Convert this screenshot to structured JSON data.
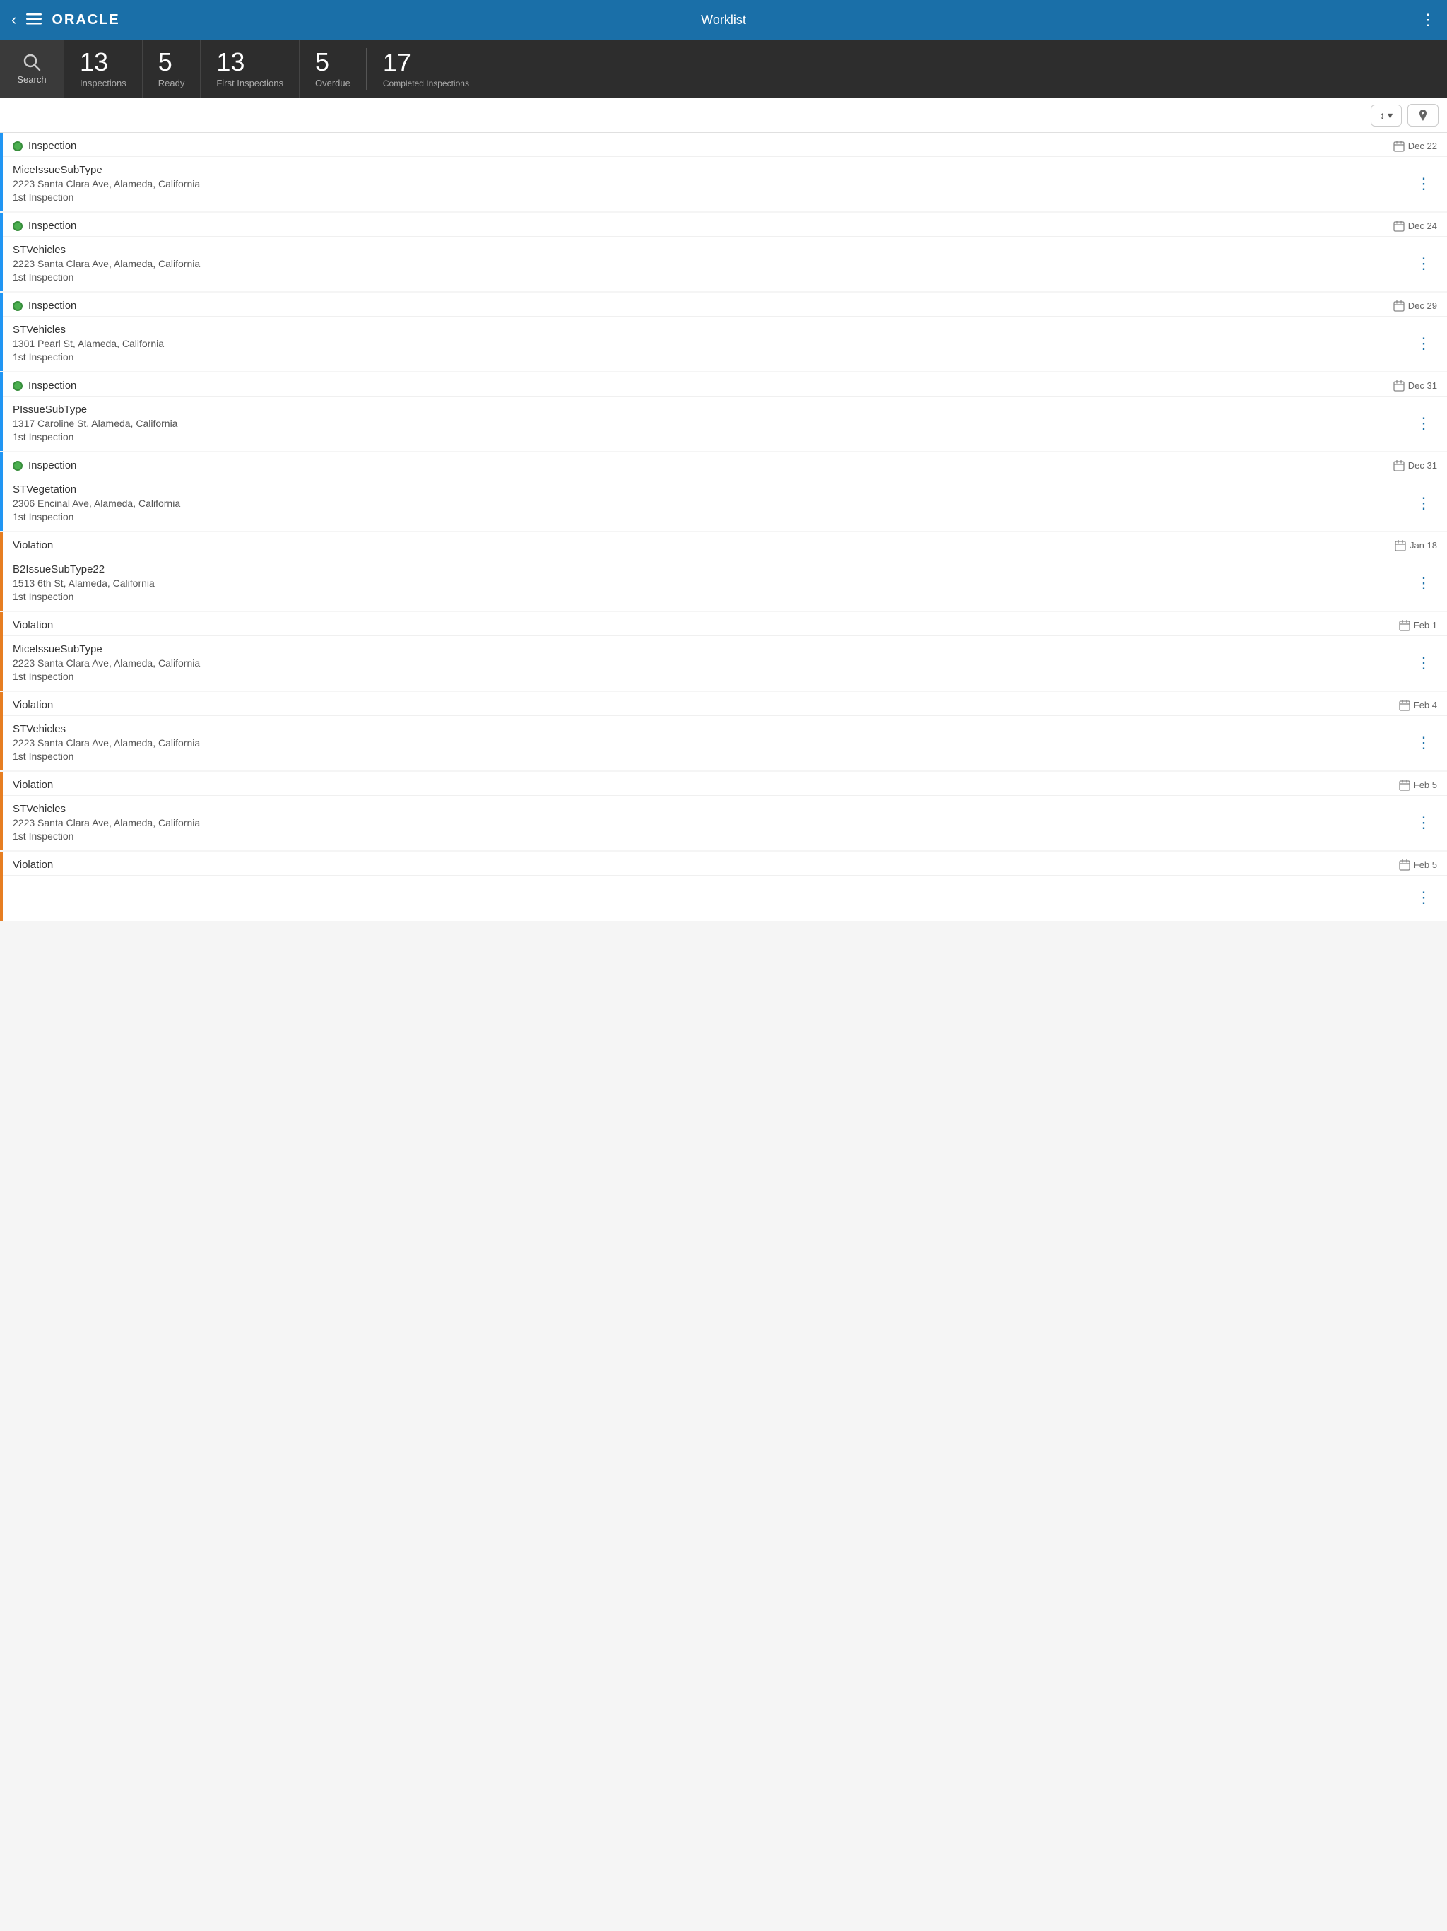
{
  "nav": {
    "title": "Worklist",
    "back_icon": "‹",
    "menu_icon": "☰",
    "more_icon": "⋮",
    "logo": "ORACLE"
  },
  "stats": {
    "search_label": "Search",
    "inspections_count": "13",
    "inspections_label": "Inspections",
    "ready_count": "5",
    "ready_label": "Ready",
    "first_inspections_count": "13",
    "first_inspections_label": "First Inspections",
    "overdue_count": "5",
    "overdue_label": "Overdue",
    "completed_count": "17",
    "completed_label": "Completed Inspections"
  },
  "toolbar": {
    "sort_label": "↕",
    "sort_arrow": "▾",
    "location_icon": "📍"
  },
  "items": [
    {
      "type": "Inspection",
      "has_dot": true,
      "dot_color": "green",
      "border": "blue",
      "date": "Dec 22",
      "subtype": "MiceIssueSubType",
      "address": "2223 Santa Clara Ave, Alameda, California",
      "inspection_type": "1st Inspection"
    },
    {
      "type": "Inspection",
      "has_dot": true,
      "dot_color": "green",
      "border": "blue",
      "date": "Dec 24",
      "subtype": "STVehicles",
      "address": "2223 Santa Clara Ave, Alameda, California",
      "inspection_type": "1st Inspection"
    },
    {
      "type": "Inspection",
      "has_dot": true,
      "dot_color": "green",
      "border": "blue",
      "date": "Dec 29",
      "subtype": "STVehicles",
      "address": "1301 Pearl St, Alameda, California",
      "inspection_type": "1st Inspection"
    },
    {
      "type": "Inspection",
      "has_dot": true,
      "dot_color": "green",
      "border": "blue",
      "date": "Dec 31",
      "subtype": "PIssueSubType",
      "address": "1317 Caroline St, Alameda, California",
      "inspection_type": "1st Inspection"
    },
    {
      "type": "Inspection",
      "has_dot": true,
      "dot_color": "green",
      "border": "blue",
      "date": "Dec 31",
      "subtype": "STVegetation",
      "address": "2306 Encinal Ave, Alameda, California",
      "inspection_type": "1st Inspection"
    },
    {
      "type": "Violation",
      "has_dot": false,
      "border": "orange",
      "date": "Jan 18",
      "subtype": "B2IssueSubType22",
      "address": "1513 6th St, Alameda, California",
      "inspection_type": "1st Inspection"
    },
    {
      "type": "Violation",
      "has_dot": false,
      "border": "orange",
      "date": "Feb 1",
      "subtype": "MiceIssueSubType",
      "address": "2223 Santa Clara Ave, Alameda, California",
      "inspection_type": "1st Inspection"
    },
    {
      "type": "Violation",
      "has_dot": false,
      "border": "orange",
      "date": "Feb 4",
      "subtype": "STVehicles",
      "address": "2223 Santa Clara Ave, Alameda, California",
      "inspection_type": "1st Inspection"
    },
    {
      "type": "Violation",
      "has_dot": false,
      "border": "orange",
      "date": "Feb 5",
      "subtype": "STVehicles",
      "address": "2223 Santa Clara Ave, Alameda, California",
      "inspection_type": "1st Inspection"
    },
    {
      "type": "Violation",
      "has_dot": false,
      "border": "orange",
      "date": "Feb 5",
      "subtype": "",
      "address": "",
      "inspection_type": ""
    }
  ]
}
